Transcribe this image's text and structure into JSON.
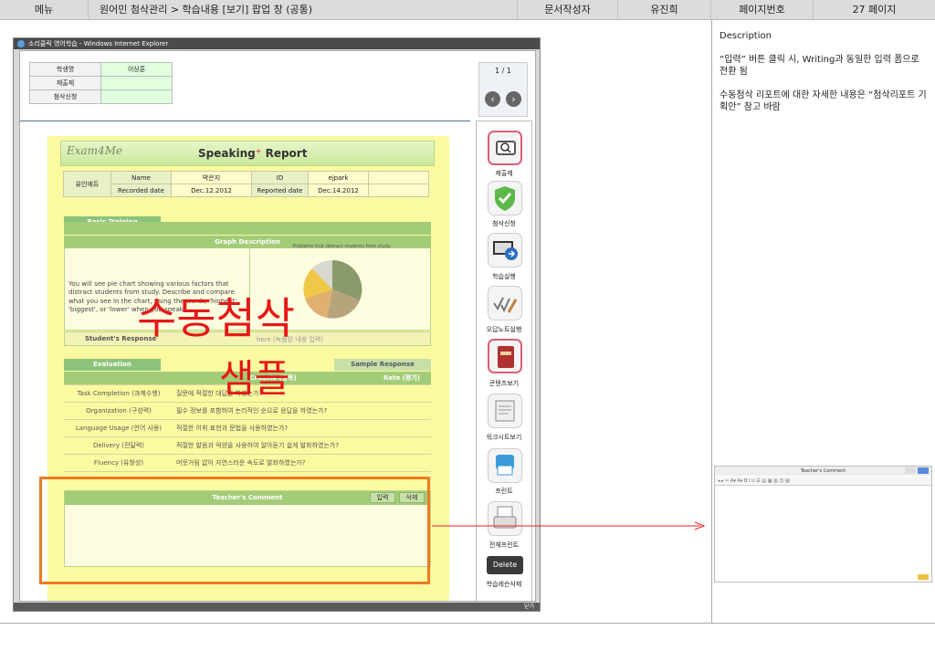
{
  "header": {
    "menu_label": "메뉴",
    "menu_path": "원어민 첨삭관리 > 학습내용 [보기] 팝업 창 (공통)",
    "author_label": "문서작성자",
    "author": "유진희",
    "page_label": "페이지번호",
    "page_value": "27 페이지"
  },
  "description": {
    "title": "Description",
    "note1": "“입력” 버튼 클릭 시, Writing과 동일한 입력 폼으로 전환 됨",
    "note2": "수동첨삭 리포트에 대한 자세한 내용은 “첨삭리포트 기획안” 참고 바람"
  },
  "window": {
    "title": "소리클릭 영어학습 - Windows Internet Explorer",
    "close_label": "닫기"
  },
  "student_info": {
    "rows": [
      {
        "label": "학생명",
        "value": "이상훈"
      },
      {
        "label": "제출제",
        "value": ""
      },
      {
        "label": "첨삭신청",
        "value": ""
      }
    ]
  },
  "pager": {
    "current": "1 / 1"
  },
  "report": {
    "logo": "Exam4Me",
    "title": "Speaking",
    "title_sup": "+",
    "title_suffix": " Report",
    "institute": "유인에듀",
    "name_label": "Name",
    "name_value": "박은지",
    "id_label": "ID",
    "id_value": "ejpark",
    "recorded_label": "Recorded date",
    "recorded_value": "Dec.12.2012",
    "reported_label": "Reported date",
    "reported_value": "Dec.14.2012",
    "basic_training": "Basic Training",
    "graph_description": "Graph Description",
    "graph_text": "You will see pie chart showing various factors that distract students from study. Describe and compare what you see in the chart, using the words, 'highest', 'biggest', or 'lower' when you speak.",
    "chart_title": "Problems that distract students from study",
    "student_response": "Student's Response",
    "response_text": "here  (녹음된 내용 입력)",
    "evaluation": "Evaluation",
    "sample_response": "Sample Response",
    "criteria_header": "Criteria (항목)",
    "rate_header": "Rate (평가)",
    "criteria": [
      {
        "item": "Task Completion (과제수행)",
        "desc": "질문에 적절한 대답을 하였는가?"
      },
      {
        "item": "Organization (구성력)",
        "desc": "필수 정보를 포함하여 논리적인 순으로 응답을 하였는가?"
      },
      {
        "item": "Language Usage (언어 사용)",
        "desc": "적절한 어휘 표현과 문법을 사용하였는가?"
      },
      {
        "item": "Delivery (전달력)",
        "desc": "적절한 발음과 억양을 사용하여 알아듣기 쉽게 발화하였는가?"
      },
      {
        "item": "Fluency (유창성)",
        "desc": "머뭇거림 없이 자연스러운 속도로 발화하였는가?"
      }
    ],
    "teacher_comment": "Teacher's Comment",
    "input_button": "입력",
    "delete_button": "삭제"
  },
  "stamp": {
    "line1": "수동첨삭",
    "line2": "샘플"
  },
  "sidebar": {
    "items": [
      {
        "label": "제출제",
        "icon": "magnifier-icon"
      },
      {
        "label": "첨삭신청",
        "icon": "shield-check-icon"
      },
      {
        "label": "학습실행",
        "icon": "monitor-arrow-icon"
      },
      {
        "label": "오답노트실행",
        "icon": "checkmark-pencil-icon"
      },
      {
        "label": "콘텐츠보기",
        "icon": "book-icon"
      },
      {
        "label": "워크시트보기",
        "icon": "document-icon"
      },
      {
        "label": "프린트",
        "icon": "printer-icon"
      },
      {
        "label": "전체프린트",
        "icon": "printer-all-icon"
      },
      {
        "label": "학습레슨삭제",
        "icon": "delete-icon"
      }
    ],
    "delete_label": "Delete"
  },
  "mini_preview": {
    "title": "Teacher's Comment"
  }
}
